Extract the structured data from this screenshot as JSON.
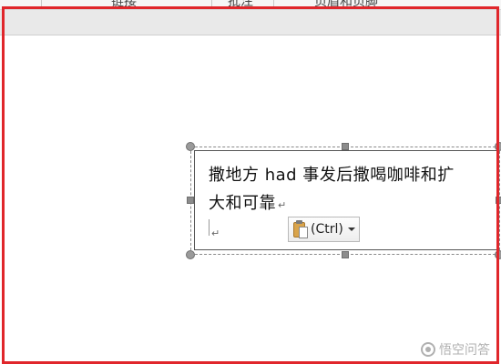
{
  "ribbon": {
    "tab_fragments": [
      "链接",
      "批注",
      "页眉和页脚"
    ]
  },
  "textbox": {
    "line1": "撒地方 had 事发后撒喝咖啡和扩",
    "line2": "大和可靠",
    "paragraph_mark": "↵"
  },
  "paste_options": {
    "label": "(Ctrl)"
  },
  "watermark": {
    "text": "悟空问答"
  },
  "colors": {
    "highlight_frame": "#e0262b",
    "paste_icon": "#d9a44b"
  }
}
